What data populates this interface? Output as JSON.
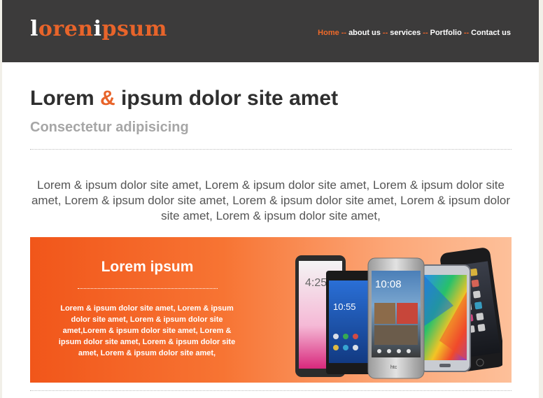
{
  "header": {
    "logo": {
      "part1": "l",
      "part2": "oren",
      "part3": "i",
      "part4": "psum"
    },
    "nav": [
      {
        "label": "Home"
      },
      {
        "label": "about us"
      },
      {
        "label": "services"
      },
      {
        "label": "Portfolio"
      },
      {
        "label": "Contact us"
      }
    ],
    "nav_separator": "--"
  },
  "main": {
    "title_part1": "Lorem",
    "title_amp": "&",
    "title_part2": "ipsum dolor site amet",
    "subtitle": "Consectetur adipisicing",
    "intro": "Lorem & ipsum dolor site amet, Lorem & ipsum dolor site amet, Lorem & ipsum dolor site amet, Lorem & ipsum dolor site amet, Lorem & ipsum dolor site amet, Lorem & ipsum dolor site amet, Lorem & ipsum dolor site amet,"
  },
  "banner": {
    "title": "Lorem ipsum",
    "text": "Lorem & ipsum dolor site amet, Lorem & ipsum dolor site amet, Lorem & ipsum dolor site amet,Lorem & ipsum dolor site amet, Lorem & ipsum dolor site amet, Lorem & ipsum dolor site amet, Lorem & ipsum dolor site amet,",
    "image": "smartphones-image",
    "phone_screen": {
      "time": "10:08",
      "time2": "10:55",
      "date_label": "4:25",
      "brand": "htc"
    }
  },
  "colors": {
    "accent": "#e8642a",
    "header_bg": "#3c3b3b",
    "banner_start": "#f1561a",
    "banner_end": "#fdc09a"
  }
}
